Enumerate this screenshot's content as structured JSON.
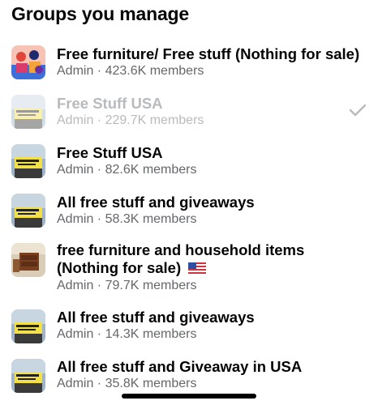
{
  "header": {
    "title": "Groups you manage"
  },
  "groups": [
    {
      "name": "Free furniture/ Free stuff (Nothing for sale)",
      "meta": "Admin · 423.6K members",
      "thumb": "group-photo-people"
    },
    {
      "name": "Free Stuff USA",
      "meta": "Admin · 229.7K members",
      "thumb": "free-giveaway-sign",
      "selected": true
    },
    {
      "name": "Free Stuff USA",
      "meta": "Admin · 82.6K members",
      "thumb": "free-giveaway-sign"
    },
    {
      "name": "All free stuff and giveaways",
      "meta": "Admin · 58.3K members",
      "thumb": "free-giveaway-sign"
    },
    {
      "name_line1": "free furniture and household items",
      "name_line2": "(Nothing for sale)",
      "flag": "us-flag",
      "meta": "Admin · 79.7K members",
      "thumb": "furniture-photo"
    },
    {
      "name": "All free stuff and giveaways",
      "meta": "Admin · 14.3K members",
      "thumb": "free-giveaway-sign"
    },
    {
      "name": "All free stuff and Giveaway in USA",
      "meta": "Admin · 35.8K members",
      "thumb": "free-giveaway-sign"
    }
  ],
  "icons": {
    "selected": "checkmark-icon",
    "home_indicator": "home-indicator"
  }
}
